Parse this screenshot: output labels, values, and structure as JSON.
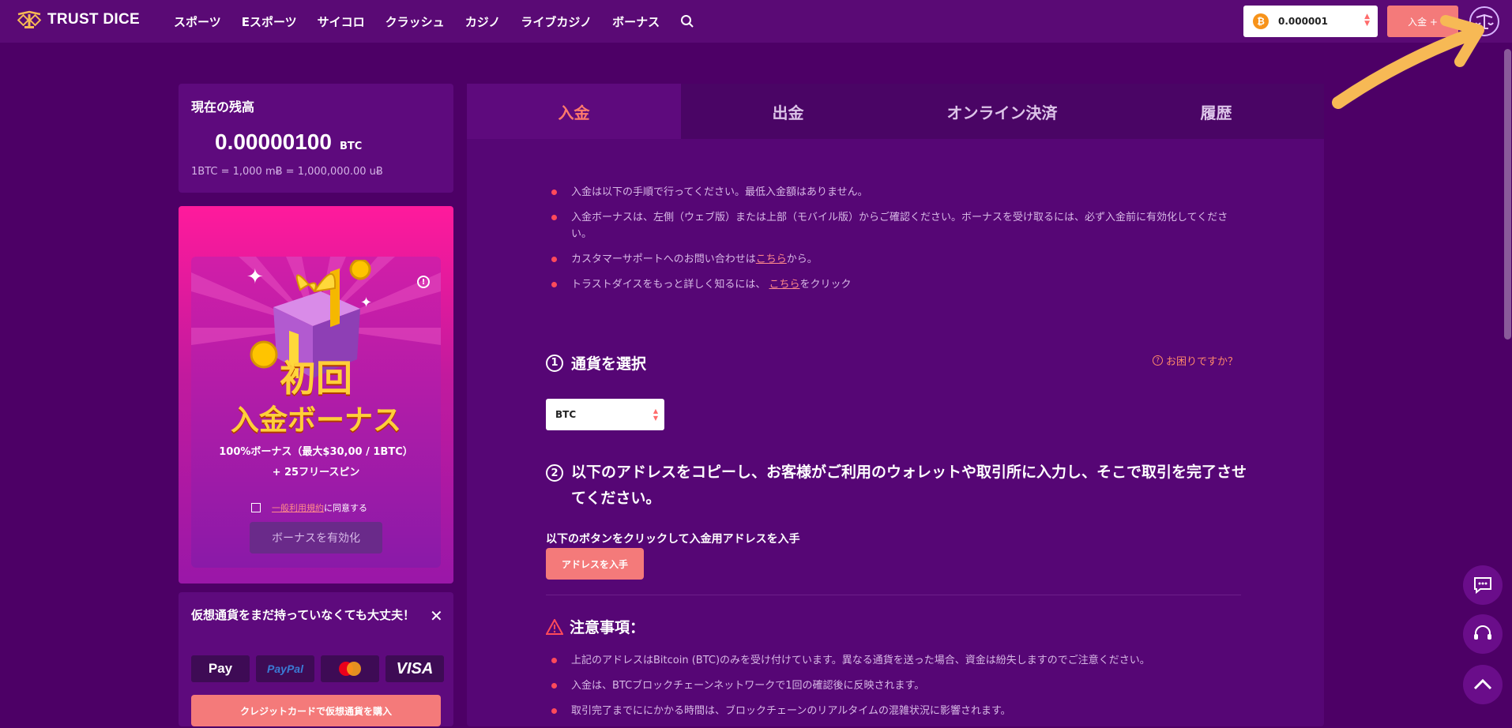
{
  "header": {
    "brand": "TRUST DICE",
    "nav": [
      "スポーツ",
      "Eスポーツ",
      "サイコロ",
      "クラッシュ",
      "カジノ",
      "ライブカジノ",
      "ボーナス"
    ],
    "wallet_amount": "0.000001",
    "wallet_currency_icon": "bitcoin-icon",
    "deposit_label": "入金 +"
  },
  "balance": {
    "title": "現在の残高",
    "amount": "0.00000100",
    "unit": "BTC",
    "conversion": "1BTC = 1,000 mɃ = 1,000,000.00 uɃ"
  },
  "bonus": {
    "title_line1": "初回",
    "title_line2": "入金ボーナス",
    "desc1": "100%ボーナス（最大$30,00 / 1BTC）",
    "desc2": "+ 25フリースピン",
    "terms_link": "一般利用規約",
    "terms_suffix": "に同意する",
    "activate_label": "ボーナスを有効化"
  },
  "crypto_banner": {
    "title": "仮想通貨をまだ持っていなくても大丈夫！",
    "payment_methods": [
      "Pay",
      "PayPal",
      "mastercard",
      "VISA"
    ],
    "buy_label": "クレジットカードで仮想通貨を購入"
  },
  "tabs": [
    {
      "label": "入金",
      "active": true
    },
    {
      "label": "出金",
      "active": false
    },
    {
      "label": "オンライン決済",
      "active": false
    },
    {
      "label": "履歴",
      "active": false
    }
  ],
  "deposit": {
    "bullets": [
      {
        "text": "入金は以下の手順で行ってください。最低入金額はありません。"
      },
      {
        "text": "入金ボーナスは、左側（ウェブ版）または上部（モバイル版）からご確認ください。ボーナスを受け取るには、必ず入金前に有効化してください。"
      },
      {
        "before": "カスタマーサポートへのお問い合わせは",
        "link": "こちら",
        "after": "から。"
      },
      {
        "before": "トラストダイスをもっと詳しく知るには、",
        "link": "こちら",
        "after": "をクリック"
      }
    ],
    "step1_num": "1",
    "step1_title": "通貨を選択",
    "help_label": "お困りですか？",
    "currency_selected": "BTC",
    "step2_num": "2",
    "step2_title": "以下のアドレスをコピーし、お客様がご利用のウォレットや取引所に入力し、そこで取引を完了させてください。",
    "instruction": "以下のボタンをクリックして入金用アドレスを入手",
    "get_address_label": "アドレスを入手",
    "caution_title": "注意事項：",
    "notes": [
      "上記のアドレスはBitcoin (BTC)のみを受け付けています。異なる通貨を送った場合、資金は紛失しますのでご注意ください。",
      "入金は、BTCブロックチェーンネットワークで1回の確認後に反映されます。",
      "取引完了までににかかる時間は、ブロックチェーンのリアルタイムの混雑状況に影響されます。"
    ]
  },
  "colors": {
    "background": "#4d0066",
    "accent": "#f47a7a",
    "active_tab": "#ff7a6b",
    "bonus_gold": "#ffcf3a",
    "annotation_arrow": "#f7b955"
  }
}
